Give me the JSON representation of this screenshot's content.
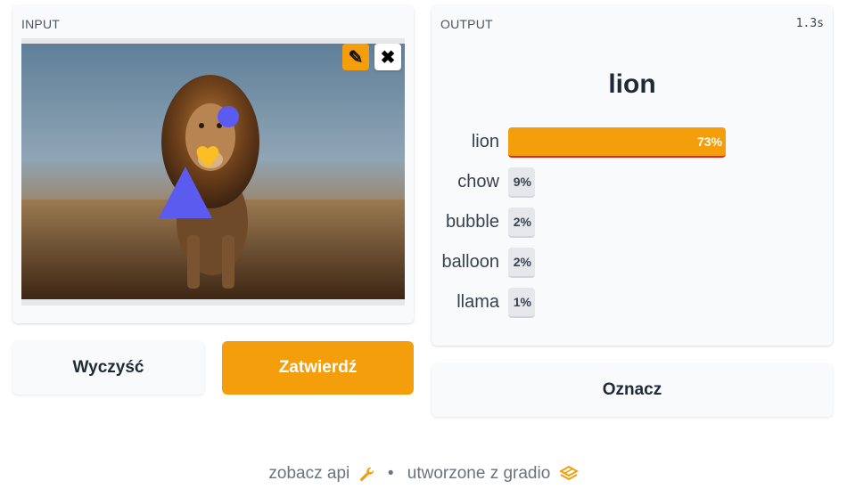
{
  "input": {
    "label": "INPUT",
    "edit_icon": "pencil-icon",
    "clear_icon": "close-icon",
    "edit_glyph": "✎",
    "clear_glyph": "✖"
  },
  "output": {
    "label": "OUTPUT",
    "timing": "1.3s",
    "top_label": "lion",
    "confidences": [
      {
        "label": "lion",
        "value": "73%",
        "fraction": 0.73
      },
      {
        "label": "chow",
        "value": "9%",
        "fraction": 0.09
      },
      {
        "label": "bubble",
        "value": "2%",
        "fraction": 0.02
      },
      {
        "label": "balloon",
        "value": "2%",
        "fraction": 0.02
      },
      {
        "label": "llama",
        "value": "1%",
        "fraction": 0.01
      }
    ]
  },
  "buttons": {
    "clear": "Wyczyść",
    "submit": "Zatwierdź",
    "flag": "Oznacz"
  },
  "footer": {
    "api_link": "zobacz api",
    "separator": "•",
    "built_with": "utworzone z gradio"
  },
  "colors": {
    "accent": "#f59e0b",
    "panel": "#f9fafb",
    "shape_blue": "#5b5bf0",
    "shape_yellow": "#fbbf24"
  }
}
